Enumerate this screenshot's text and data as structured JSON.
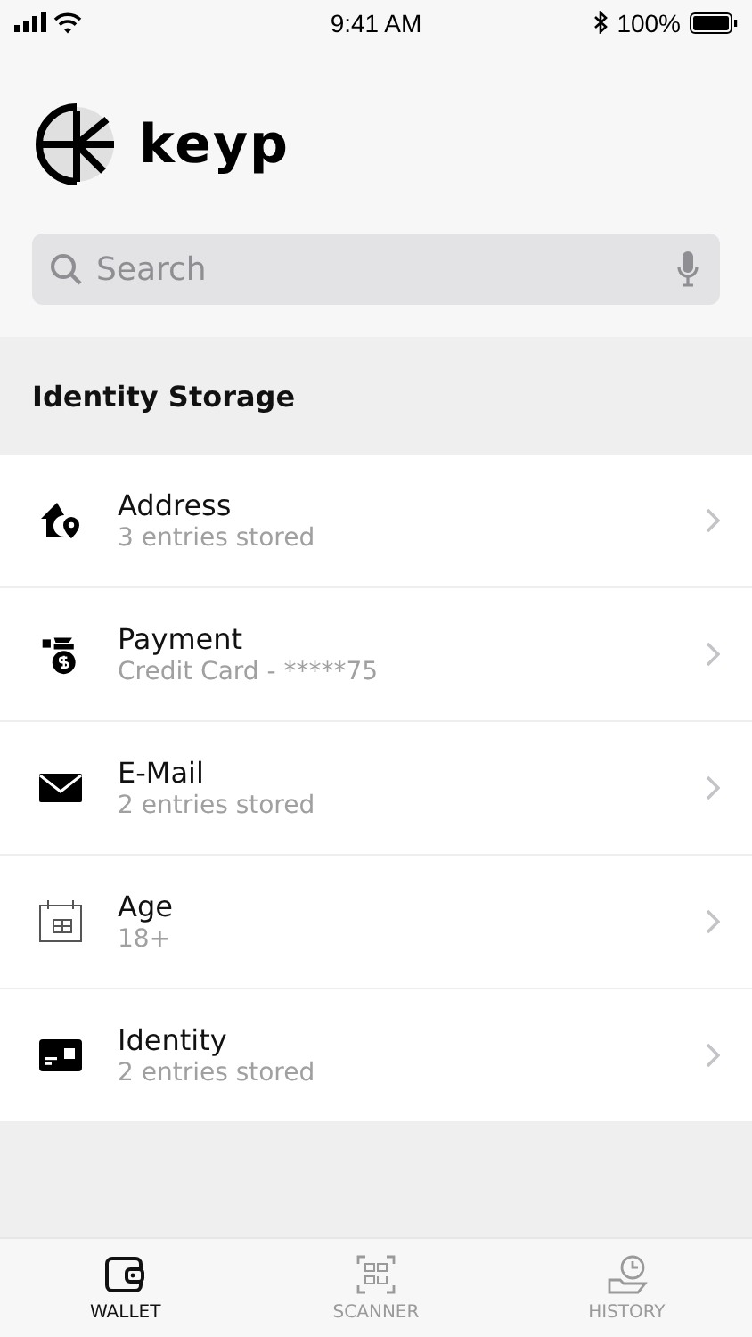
{
  "status_bar": {
    "time": "9:41 AM",
    "battery": "100%"
  },
  "logo": "keyp",
  "search": {
    "placeholder": "Search"
  },
  "section": {
    "title": "Identity Storage"
  },
  "items": [
    {
      "kind": "address",
      "title": "Address",
      "subtitle": "3 entries stored"
    },
    {
      "kind": "payment",
      "title": "Payment",
      "subtitle": "Credit Card - *****75"
    },
    {
      "kind": "email",
      "title": "E-Mail",
      "subtitle": "2 entries stored"
    },
    {
      "kind": "age",
      "title": "Age",
      "subtitle": "18+"
    },
    {
      "kind": "identity",
      "title": "Identity",
      "subtitle": "2 entries stored"
    }
  ],
  "tabs": [
    {
      "kind": "wallet",
      "label": "WALLET",
      "selected": true
    },
    {
      "kind": "scanner",
      "label": "SCANNER",
      "selected": false
    },
    {
      "kind": "history",
      "label": "HISTORY",
      "selected": false
    }
  ]
}
